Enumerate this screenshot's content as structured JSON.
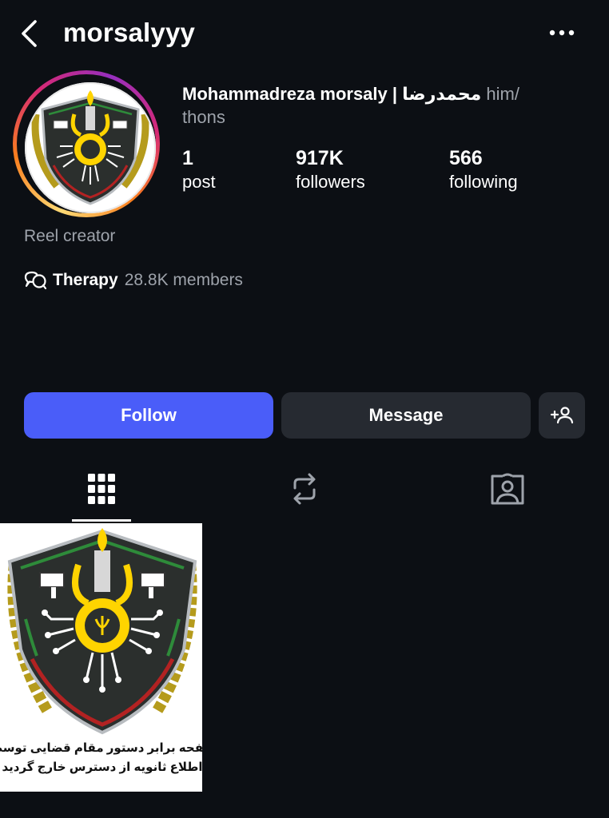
{
  "header": {
    "username": "morsalyyy",
    "back_icon": "chevron-left-icon",
    "more_icon": "more-horizontal-icon"
  },
  "profile": {
    "display_name": "Mohammadreza morsaly",
    "separator": "|",
    "display_name_persian": "محمدرضا",
    "pronouns_line1": "him/",
    "pronouns_line2": "thons",
    "stats": {
      "posts_count": "1",
      "posts_label": "post",
      "followers_count": "917K",
      "followers_label": "followers",
      "following_count": "566",
      "following_label": "following"
    },
    "category": "Reel creator",
    "channel": {
      "icon": "broadcast-channel-icon",
      "name": "Therapy",
      "members": "28.8K members"
    }
  },
  "actions": {
    "follow_label": "Follow",
    "message_label": "Message",
    "suggest_icon": "add-person-icon"
  },
  "tabs": [
    {
      "icon": "grid-icon",
      "active": true
    },
    {
      "icon": "reposts-icon",
      "active": false
    },
    {
      "icon": "tagged-icon",
      "active": false
    }
  ],
  "posts": [
    {
      "caption_line1": "صفحه برابر دستور مقام قضایی توسط",
      "caption_line2": "تا اطلاع ثانویه از دسترس خارج گردید"
    }
  ],
  "colors": {
    "background": "#0c0f14",
    "follow_button": "#4a5df9",
    "secondary_button": "#262a31",
    "muted_text": "#9ea3ab"
  }
}
